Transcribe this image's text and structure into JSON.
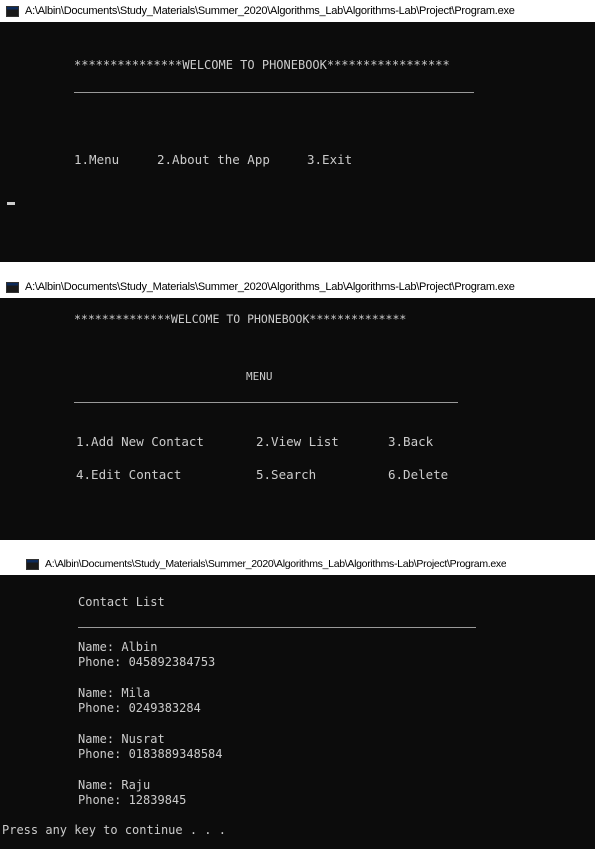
{
  "window_title": "A:\\Albin\\Documents\\Study_Materials\\Summer_2020\\Algorithms_Lab\\Algorithms-Lab\\Project\\Program.exe",
  "screen1": {
    "banner": "***************WELCOME TO PHONEBOOK*****************",
    "options": [
      "1.Menu",
      "2.About the App",
      "3.Exit"
    ]
  },
  "screen2": {
    "banner": "**************WELCOME TO PHONEBOOK**************",
    "heading": "MENU",
    "options": [
      "1.Add New Contact",
      "2.View List",
      "3.Back",
      "4.Edit Contact",
      "5.Search",
      "6.Delete"
    ]
  },
  "screen3": {
    "heading": "Contact List",
    "contacts": [
      {
        "name": "Name: Albin",
        "phone": "Phone: 045892384753"
      },
      {
        "name": "Name: Mila",
        "phone": "Phone: 0249383284"
      },
      {
        "name": "Name: Nusrat",
        "phone": "Phone: 0183889348584"
      },
      {
        "name": "Name: Raju",
        "phone": "Phone: 12839845"
      }
    ],
    "prompt": "Press any key to continue . . ."
  },
  "colors": {
    "console_bg": "#0c0c0c",
    "console_text": "#cccccc",
    "titlebar_bg": "#ffffff"
  }
}
